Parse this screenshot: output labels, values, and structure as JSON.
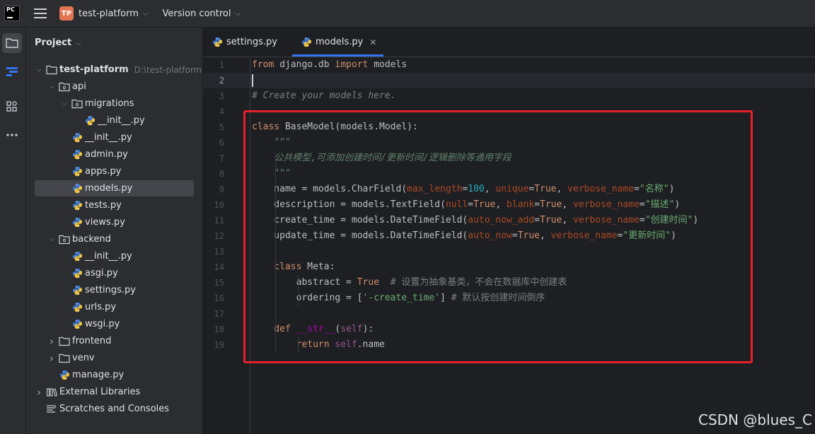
{
  "titlebar": {
    "app_logo": "PC",
    "project_badge": "TP",
    "project_name": "test-platform",
    "vcs_label": "Version control"
  },
  "project_panel": {
    "title": "Project",
    "tree": [
      {
        "label": "test-platform",
        "path": "D:\\test-platform",
        "icon": "folder-icon",
        "expanded": true
      },
      {
        "label": "api",
        "icon": "package-folder-icon",
        "expanded": true
      },
      {
        "label": "migrations",
        "icon": "package-folder-icon",
        "expanded": true
      },
      {
        "label": "__init__.py",
        "icon": "python-file-icon"
      },
      {
        "label": "__init__.py",
        "icon": "python-file-icon"
      },
      {
        "label": "admin.py",
        "icon": "python-file-icon"
      },
      {
        "label": "apps.py",
        "icon": "python-file-icon"
      },
      {
        "label": "models.py",
        "icon": "python-file-icon",
        "selected": true
      },
      {
        "label": "tests.py",
        "icon": "python-file-icon"
      },
      {
        "label": "views.py",
        "icon": "python-file-icon"
      },
      {
        "label": "backend",
        "icon": "package-folder-icon",
        "expanded": true
      },
      {
        "label": "__init__.py",
        "icon": "python-file-icon"
      },
      {
        "label": "asgi.py",
        "icon": "python-file-icon"
      },
      {
        "label": "settings.py",
        "icon": "python-file-icon"
      },
      {
        "label": "urls.py",
        "icon": "python-file-icon"
      },
      {
        "label": "wsgi.py",
        "icon": "python-file-icon"
      },
      {
        "label": "frontend",
        "icon": "folder-icon",
        "expanded": false
      },
      {
        "label": "venv",
        "icon": "folder-icon",
        "expanded": false
      },
      {
        "label": "manage.py",
        "icon": "python-file-icon"
      },
      {
        "label": "External Libraries",
        "icon": "library-icon",
        "expanded": false
      },
      {
        "label": "Scratches and Consoles",
        "icon": "scratches-icon"
      }
    ]
  },
  "editor": {
    "tabs": [
      {
        "label": "settings.py",
        "active": false
      },
      {
        "label": "models.py",
        "active": true
      }
    ],
    "current_line": 2,
    "lines": [
      {
        "n": "1",
        "tokens": [
          [
            "kw",
            "from"
          ],
          [
            "",
            " django.db "
          ],
          [
            "kw",
            "import"
          ],
          [
            "",
            " models"
          ]
        ]
      },
      {
        "n": "2",
        "tokens": []
      },
      {
        "n": "3",
        "tokens": [
          [
            "cm",
            "# Create your models here."
          ]
        ]
      },
      {
        "n": "4",
        "tokens": []
      },
      {
        "n": "5",
        "tokens": [
          [
            "kw",
            "class"
          ],
          [
            "",
            " BaseModel(models.Model):"
          ]
        ]
      },
      {
        "n": "6",
        "tokens": [
          [
            "doc",
            "    \"\"\""
          ]
        ]
      },
      {
        "n": "7",
        "tokens": [
          [
            "doc",
            "    公共模型,可添加创建时间/更新时间/逻辑删除等通用字段"
          ]
        ]
      },
      {
        "n": "8",
        "tokens": [
          [
            "doc",
            "    \"\"\""
          ]
        ]
      },
      {
        "n": "9",
        "tokens": [
          [
            "",
            "    name = models.CharField("
          ],
          [
            "par",
            "max_length"
          ],
          [
            "",
            "="
          ],
          [
            "num",
            "100"
          ],
          [
            "",
            ", "
          ],
          [
            "par",
            "unique"
          ],
          [
            "",
            "="
          ],
          [
            "kw",
            "True"
          ],
          [
            "",
            ", "
          ],
          [
            "par",
            "verbose_name"
          ],
          [
            "",
            "="
          ],
          [
            "str",
            "\"名称\""
          ],
          [
            "",
            ")"
          ]
        ]
      },
      {
        "n": "10",
        "tokens": [
          [
            "",
            "    description = models.TextField("
          ],
          [
            "par",
            "null"
          ],
          [
            "",
            "="
          ],
          [
            "kw",
            "True"
          ],
          [
            "",
            ", "
          ],
          [
            "par",
            "blank"
          ],
          [
            "",
            "="
          ],
          [
            "kw",
            "True"
          ],
          [
            "",
            ", "
          ],
          [
            "par",
            "verbose_name"
          ],
          [
            "",
            "="
          ],
          [
            "str",
            "\"描述\""
          ],
          [
            "",
            ")"
          ]
        ]
      },
      {
        "n": "11",
        "tokens": [
          [
            "",
            "    create_time = models.DateTimeField("
          ],
          [
            "par",
            "auto_now_add"
          ],
          [
            "",
            "="
          ],
          [
            "kw",
            "True"
          ],
          [
            "",
            ", "
          ],
          [
            "par",
            "verbose_name"
          ],
          [
            "",
            "="
          ],
          [
            "str",
            "\"创建时间\""
          ],
          [
            "",
            ")"
          ]
        ]
      },
      {
        "n": "12",
        "tokens": [
          [
            "",
            "    update_time = models.DateTimeField("
          ],
          [
            "par",
            "auto_now"
          ],
          [
            "",
            "="
          ],
          [
            "kw",
            "True"
          ],
          [
            "",
            ", "
          ],
          [
            "par",
            "verbose_name"
          ],
          [
            "",
            "="
          ],
          [
            "str",
            "\"更新时间\""
          ],
          [
            "",
            ")"
          ]
        ]
      },
      {
        "n": "13",
        "tokens": []
      },
      {
        "n": "14",
        "tokens": [
          [
            "",
            "    "
          ],
          [
            "kw",
            "class"
          ],
          [
            "",
            " Meta:"
          ]
        ]
      },
      {
        "n": "15",
        "tokens": [
          [
            "",
            "        abstract = "
          ],
          [
            "kw",
            "True"
          ],
          [
            "",
            "  "
          ],
          [
            "cmn",
            "# 设置为抽象基类，不会在数据库中创建表"
          ]
        ]
      },
      {
        "n": "16",
        "tokens": [
          [
            "",
            "        ordering = ["
          ],
          [
            "str",
            "'-create_time'"
          ],
          [
            "",
            "] "
          ],
          [
            "cmn",
            "# 默认按创建时间倒序"
          ]
        ]
      },
      {
        "n": "17",
        "tokens": []
      },
      {
        "n": "18",
        "tokens": [
          [
            "",
            "    "
          ],
          [
            "kw",
            "def"
          ],
          [
            "",
            " "
          ],
          [
            "dunder",
            "__str__"
          ],
          [
            "",
            "("
          ],
          [
            "selfk",
            "self"
          ],
          [
            "",
            "):"
          ]
        ]
      },
      {
        "n": "19",
        "tokens": [
          [
            "",
            "        "
          ],
          [
            "kw",
            "return"
          ],
          [
            "",
            " "
          ],
          [
            "selfk",
            "self"
          ],
          [
            "",
            ".name"
          ]
        ]
      }
    ]
  },
  "watermark": "CSDN @blues_C",
  "colors": {
    "accent": "#3574f0",
    "highlight_box": "#e8202a",
    "keyword": "#cf8e6d",
    "string": "#6aab73",
    "number": "#2aacb8"
  }
}
